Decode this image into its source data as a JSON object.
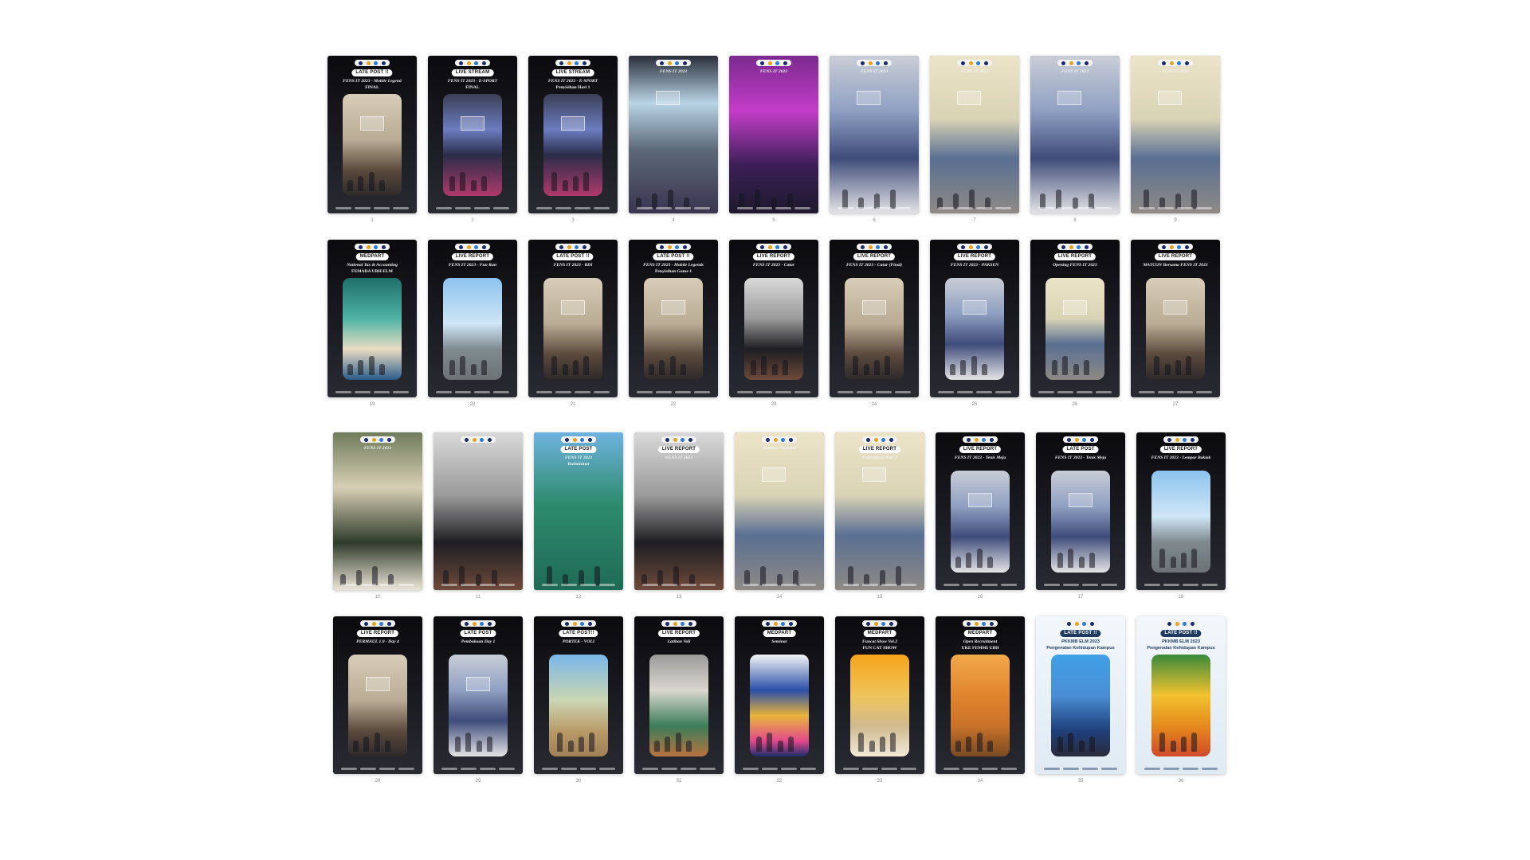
{
  "colors": {
    "background": "#ffffff",
    "card_dark": "#111116",
    "pill_bg": "#ffffff",
    "logo_bar": "#f2f2f2"
  },
  "logo_dots": [
    "#1b2a6b",
    "#e6a21a",
    "#2b7bd0",
    "#1b2a6b"
  ],
  "rows": [
    {
      "cards": [
        {
          "number": "1",
          "pill": "LATE POST !!",
          "title": "FENS IT 2023 - Mobile Legend",
          "subtitle": "FINAL",
          "scene": "sc-room",
          "pale": false
        },
        {
          "number": "2",
          "pill": "LIVE STREAM",
          "title": "FENS IT 2023 - E-SPORT",
          "subtitle": "FINAL",
          "scene": "sc-game",
          "pale": false
        },
        {
          "number": "3",
          "pill": "LIVE STREAM",
          "title": "FENS IT 2023 - E-SPORT",
          "subtitle": "Penyisihan Hari 1",
          "scene": "sc-game",
          "pale": false
        },
        {
          "number": "4",
          "pill": "",
          "title": "FENS IT 2023",
          "subtitle": "",
          "scene": "sc-stage",
          "pale": false,
          "full": true
        },
        {
          "number": "5",
          "pill": "",
          "title": "FENS IT 2023",
          "subtitle": "",
          "scene": "sc-purple",
          "pale": false,
          "full": true
        },
        {
          "number": "6",
          "pill": "",
          "title": "FENS IT 2023",
          "subtitle": "",
          "scene": "sc-lab",
          "pale": false,
          "full": true
        },
        {
          "number": "7",
          "pill": "",
          "title": "FENS IT 2023",
          "subtitle": "",
          "scene": "sc-class",
          "pale": false,
          "full": true
        },
        {
          "number": "8",
          "pill": "",
          "title": "FENS IT 2023",
          "subtitle": "",
          "scene": "sc-lab",
          "pale": false,
          "full": true
        },
        {
          "number": "9",
          "pill": "",
          "title": "FENS IT 2023",
          "subtitle": "",
          "scene": "sc-class",
          "pale": false,
          "full": true
        }
      ]
    },
    {
      "cards": [
        {
          "number": "19",
          "pill": "MEDPART",
          "title": "National Tax & Accounting",
          "subtitle": "FEMADA UBH ELM",
          "scene": "sc-poster",
          "pale": false
        },
        {
          "number": "20",
          "pill": "LIVE REPORT",
          "title": "FENS IT 2023 - Fun Run",
          "subtitle": "",
          "scene": "sc-outdoor",
          "pale": false
        },
        {
          "number": "21",
          "pill": "LATE POST !!",
          "title": "FENS IT 2023 - BDI",
          "subtitle": "",
          "scene": "sc-room",
          "pale": false
        },
        {
          "number": "22",
          "pill": "LATE POST !!",
          "title": "FENS IT 2023 - Mobile Legends",
          "subtitle": "Penyisihan Game 1",
          "scene": "sc-room",
          "pale": false
        },
        {
          "number": "23",
          "pill": "LIVE REPORT",
          "title": "FENS IT 2023 - Catur",
          "subtitle": "",
          "scene": "sc-hall",
          "pale": false
        },
        {
          "number": "24",
          "pill": "LIVE REPORT",
          "title": "FENS IT 2023 - Catur (Final)",
          "subtitle": "",
          "scene": "sc-room",
          "pale": false
        },
        {
          "number": "25",
          "pill": "LIVE REPORT",
          "title": "FENS IT 2023 - PAKSEN",
          "subtitle": "",
          "scene": "sc-lab",
          "pale": false
        },
        {
          "number": "26",
          "pill": "LIVE REPORT",
          "title": "Opening FENS IT 2023",
          "subtitle": "",
          "scene": "sc-class",
          "pale": false
        },
        {
          "number": "27",
          "pill": "LIVE REPORT",
          "title": "MATCON Bersama FENS IT 2023",
          "subtitle": "",
          "scene": "sc-room",
          "pale": false
        }
      ]
    },
    {
      "cards": [
        {
          "number": "10",
          "pill": "",
          "title": "FENS IT 2023",
          "subtitle": "",
          "scene": "sc-green",
          "pale": false,
          "full": true
        },
        {
          "number": "11",
          "pill": "",
          "title": "",
          "subtitle": "",
          "scene": "sc-hall",
          "pale": false,
          "full": true
        },
        {
          "number": "12",
          "pill": "LATE POST",
          "title": "FENS IT 2023",
          "subtitle": "Badminton",
          "scene": "sc-court",
          "pale": false,
          "full": true
        },
        {
          "number": "13",
          "pill": "LIVE REPORT",
          "title": "FENS IT 2023",
          "subtitle": "",
          "scene": "sc-hall",
          "pale": false,
          "full": true
        },
        {
          "number": "14",
          "pill": "",
          "title": "Seminar Nasional",
          "subtitle": "",
          "scene": "sc-class",
          "pale": false,
          "full": true
        },
        {
          "number": "15",
          "pill": "LIVE REPORT",
          "title": "Pembukaan Hari 2",
          "subtitle": "",
          "scene": "sc-class",
          "pale": false,
          "full": true
        },
        {
          "number": "16",
          "pill": "LIVE REPORT",
          "title": "FENS IT 2023 - Tenis Meja",
          "subtitle": "",
          "scene": "sc-lab",
          "pale": false
        },
        {
          "number": "17",
          "pill": "LATE POST",
          "title": "FENS IT 2023 - Tenis Meja",
          "subtitle": "",
          "scene": "sc-lab",
          "pale": false
        },
        {
          "number": "18",
          "pill": "LIVE REPORT",
          "title": "FENS IT 2023 - Lempar Bakiak",
          "subtitle": "",
          "scene": "sc-outdoor",
          "pale": false
        }
      ]
    },
    {
      "cards": [
        {
          "number": "28",
          "pill": "LIVE REPORT",
          "title": "PERMAUL 1.0 - Day 4",
          "subtitle": "",
          "scene": "sc-room",
          "pale": false
        },
        {
          "number": "29",
          "pill": "LATE POST",
          "title": "Pembukaan Day 1",
          "subtitle": "",
          "scene": "sc-lab",
          "pale": false
        },
        {
          "number": "30",
          "pill": "LATE POST!!",
          "title": "PORTEK - VOLI",
          "subtitle": "",
          "scene": "sc-field",
          "pale": false
        },
        {
          "number": "31",
          "pill": "LIVE REPORT",
          "title": "Latihan Voli",
          "subtitle": "",
          "scene": "sc-gym",
          "pale": false
        },
        {
          "number": "32",
          "pill": "MEDPART",
          "title": "Seminar",
          "subtitle": "",
          "scene": "sc-blueposter",
          "pale": false
        },
        {
          "number": "33",
          "pill": "MEDPART",
          "title": "Funcat Show Vol.2",
          "subtitle": "FUN CAT SHOW",
          "scene": "sc-funcat",
          "pale": false
        },
        {
          "number": "34",
          "pill": "MEDPART",
          "title": "Open Recruitment",
          "subtitle": "UKE FEMMI UBH",
          "scene": "sc-orange",
          "pale": false
        },
        {
          "number": "35",
          "pill": "LATE POST !!",
          "title": "PKKMB ELM 2023",
          "subtitle": "Pengenalan Kehidupan Kampus",
          "scene": "sc-bluecard",
          "pale": true
        },
        {
          "number": "36",
          "pill": "LATE POST !!",
          "title": "PKKMB ELM 2023",
          "subtitle": "Pengenalan Kehidupan Kampus",
          "scene": "sc-crowd",
          "pale": true
        }
      ]
    }
  ]
}
